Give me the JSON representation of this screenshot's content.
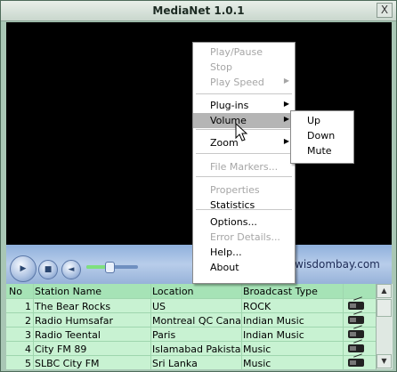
{
  "window": {
    "title": "MediaNet 1.0.1",
    "close_label": "X"
  },
  "brand": {
    "text": "wisdombay.com"
  },
  "volume": {
    "level": 0.45
  },
  "context_menu": {
    "items": [
      {
        "label": "Play/Pause",
        "enabled": false,
        "submenu": false
      },
      {
        "label": "Stop",
        "enabled": false,
        "submenu": false
      },
      {
        "label": "Play Speed",
        "enabled": false,
        "submenu": true
      },
      {
        "label": "Plug-ins",
        "enabled": true,
        "submenu": true
      },
      {
        "label": "Volume",
        "enabled": true,
        "submenu": true,
        "highlighted": true
      },
      {
        "label": "Zoom",
        "enabled": true,
        "submenu": true
      },
      {
        "label": "File Markers...",
        "enabled": false,
        "submenu": false
      },
      {
        "label": "Properties",
        "enabled": false,
        "submenu": false
      },
      {
        "label": "Statistics",
        "enabled": true,
        "submenu": false
      },
      {
        "label": "Options...",
        "enabled": true,
        "submenu": false
      },
      {
        "label": "Error Details...",
        "enabled": false,
        "submenu": false
      },
      {
        "label": "Help...",
        "enabled": true,
        "submenu": false
      },
      {
        "label": "About",
        "enabled": true,
        "submenu": false
      }
    ]
  },
  "volume_submenu": {
    "items": [
      "Up",
      "Down",
      "Mute"
    ]
  },
  "station_table": {
    "headers": {
      "no": "No",
      "name": "Station Name",
      "location": "Location",
      "type": "Broadcast Type"
    },
    "rows": [
      {
        "no": "1",
        "name": "The Bear Rocks",
        "location": "US",
        "type": "ROCK",
        "icon": "radio-icon"
      },
      {
        "no": "2",
        "name": "Radio Humsafar",
        "location": "Montreal QC Canad",
        "type": "Indian Music",
        "icon": "radio-icon"
      },
      {
        "no": "3",
        "name": "Radio Teental",
        "location": "Paris",
        "type": "Indian Music",
        "icon": "radio-icon"
      },
      {
        "no": "4",
        "name": "City FM 89",
        "location": "Islamabad Pakistan",
        "type": "Music",
        "icon": "radio-icon"
      },
      {
        "no": "5",
        "name": "SLBC City FM",
        "location": "Sri Lanka",
        "type": "Music",
        "icon": "radio-icon"
      }
    ]
  },
  "colors": {
    "menu_highlight": "#b5b5b5",
    "table_header": "#a6e3b6",
    "table_row": "#c8f2d2",
    "video": "#000000"
  }
}
